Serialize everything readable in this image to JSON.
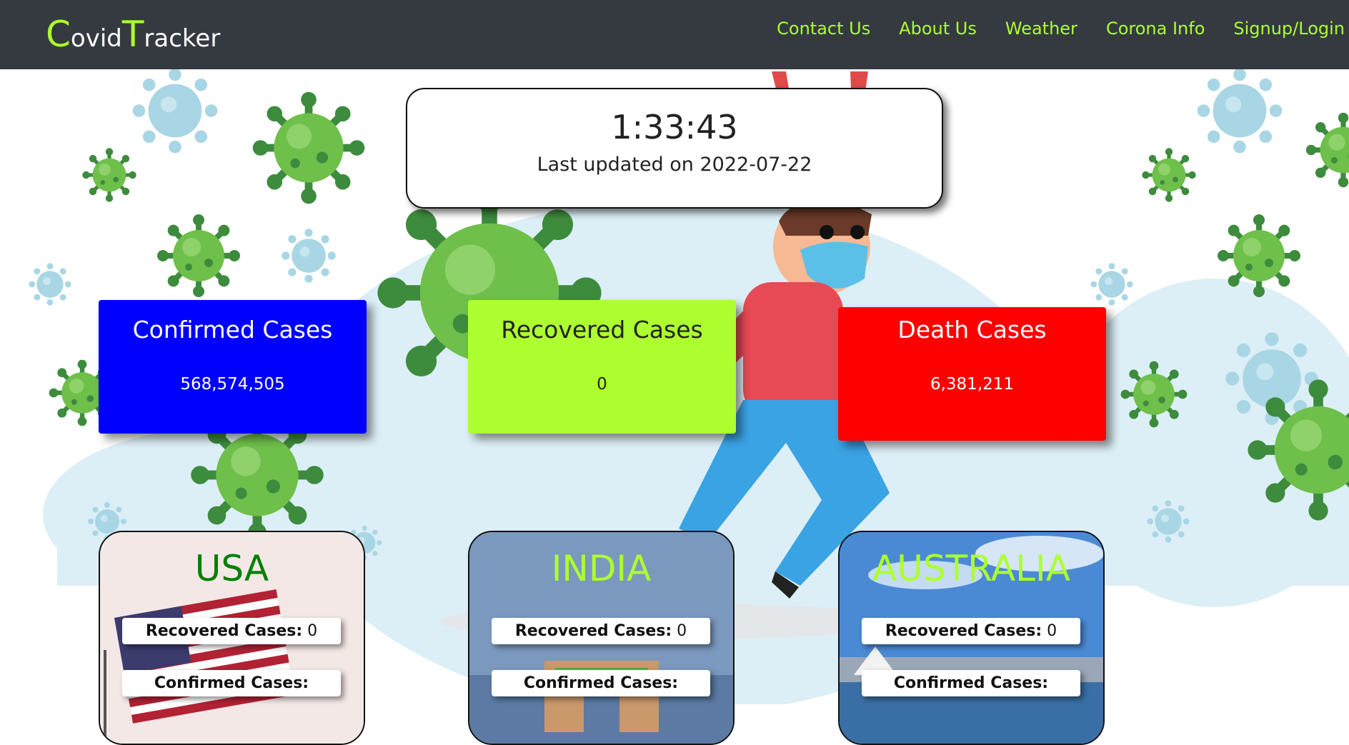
{
  "nav": {
    "brand_c": "C",
    "brand_ovid": "ovid",
    "brand_t": "T",
    "brand_racker": "racker",
    "links": [
      "Contact Us",
      "About Us",
      "Weather",
      "Corona Info",
      "Signup/Login"
    ]
  },
  "clock": {
    "time": "1:33:43",
    "updated": "Last updated on 2022-07-22"
  },
  "stats": [
    {
      "title": "Confirmed Cases",
      "value": "568,574,505",
      "bg": "#0000ff",
      "fg": "#ffffff"
    },
    {
      "title": "Recovered Cases",
      "value": "0",
      "bg": "#adff2f",
      "fg": "#222222"
    },
    {
      "title": "Death Cases",
      "value": "6,381,211",
      "bg": "#ff0000",
      "fg": "#ffffff"
    }
  ],
  "countries": [
    {
      "name": "USA",
      "name_color": "#008000",
      "recovered_label": "Recovered Cases:",
      "recovered_value": "0",
      "confirmed_label": "Confirmed Cases:"
    },
    {
      "name": "INDIA",
      "name_color": "#adff2f",
      "recovered_label": "Recovered Cases:",
      "recovered_value": "0",
      "confirmed_label": "Confirmed Cases:"
    },
    {
      "name": "AUSTRALIA",
      "name_color": "#adff2f",
      "recovered_label": "Recovered Cases:",
      "recovered_value": "0",
      "confirmed_label": "Confirmed Cases:"
    }
  ],
  "colors": {
    "nav_bg": "#343a40",
    "accent": "#adff2f",
    "virus": "#5fb43a",
    "virus_pale": "#a9d6e5"
  }
}
